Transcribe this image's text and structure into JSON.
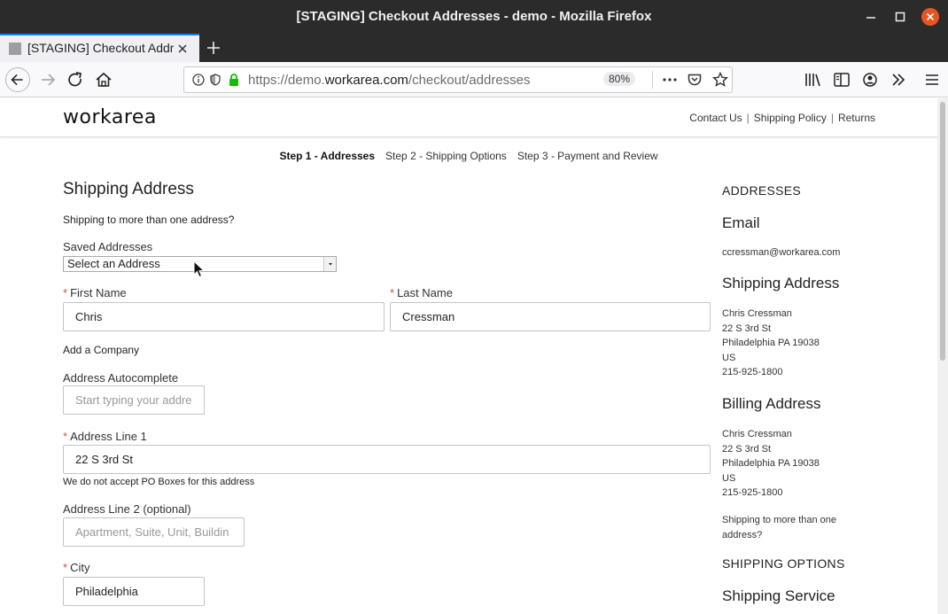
{
  "window": {
    "title": "[STAGING] Checkout Addresses - demo - Mozilla Firefox"
  },
  "tab": {
    "label": "[STAGING] Checkout Addresses"
  },
  "urlbar": {
    "scheme_prefix": "https://demo.",
    "host": "workarea.com",
    "path": "/checkout/addresses",
    "zoom": "80%"
  },
  "site": {
    "logo": "workarea",
    "util_nav": [
      "Contact Us",
      "Shipping Policy",
      "Returns"
    ]
  },
  "steps": {
    "step1": "Step 1 - Addresses",
    "step2": "Step 2 - Shipping Options",
    "step3": "Step 3 - Payment and Review"
  },
  "form": {
    "heading": "Shipping Address",
    "multi_address_link": "Shipping to more than one address?",
    "saved_addresses_label": "Saved Addresses",
    "saved_addresses_value": "Select an Address",
    "required_marker": "*",
    "first_name_label": "First Name",
    "first_name_value": "Chris",
    "last_name_label": "Last Name",
    "last_name_value": "Cressman",
    "add_company_link": "Add a Company",
    "autocomplete_label": "Address Autocomplete",
    "autocomplete_placeholder": "Start typing your addre",
    "address1_label": "Address Line 1",
    "address1_value": "22 S 3rd St",
    "po_box_note": "We do not accept PO Boxes for this address",
    "address2_label": "Address Line 2 (optional)",
    "address2_placeholder": "Apartment, Suite, Unit, Buildin",
    "city_label": "City",
    "city_value": "Philadelphia"
  },
  "summary": {
    "addresses_heading": "ADDRESSES",
    "email_heading": "Email",
    "email": "ccressman@workarea.com",
    "shipping_heading": "Shipping Address",
    "shipping_lines": [
      "Chris Cressman",
      "22 S 3rd St",
      "Philadelphia PA 19038",
      "US",
      "215-925-1800"
    ],
    "billing_heading": "Billing Address",
    "billing_lines": [
      "Chris Cressman",
      "22 S 3rd St",
      "Philadelphia PA 19038",
      "US",
      "215-925-1800"
    ],
    "multi_address_link_line1": "Shipping to more than one",
    "multi_address_link_line2": "address?",
    "shipping_options_heading": "SHIPPING OPTIONS",
    "shipping_service_heading": "Shipping Service"
  },
  "colors": {
    "titlebar": "#2b2b2b",
    "close_button": "#e95420",
    "tab_accent": "#0a84ff",
    "required": "#e04a3c",
    "lock_green": "#12bc00"
  }
}
